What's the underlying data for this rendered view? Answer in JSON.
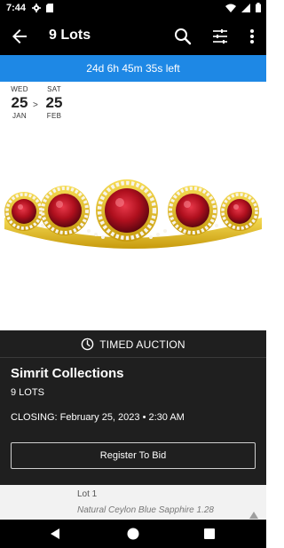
{
  "status_bar": {
    "time": "7:44",
    "icons": [
      "gear-icon",
      "sd-card-icon",
      "wifi-icon",
      "signal-icon",
      "battery-icon"
    ]
  },
  "app_bar": {
    "title": "9 Lots",
    "icons": [
      "back-arrow-icon",
      "search-icon",
      "filter-icon",
      "more-vert-icon"
    ]
  },
  "countdown": {
    "text": "24d 6h 45m 35s left",
    "color": "#1e88e5"
  },
  "date_range": {
    "start": {
      "dow": "WED",
      "day": "25",
      "month": "JAN"
    },
    "separator": ">",
    "end": {
      "dow": "SAT",
      "day": "25",
      "month": "FEB"
    }
  },
  "lot_image": {
    "icon": "ruby-ring-image",
    "gem_color": "#b0101e",
    "metal_color": "#e8c21a"
  },
  "auction": {
    "type_label": "TIMED AUCTION",
    "type_icon": "clock-icon",
    "collection_name": "Simrit Collections",
    "lot_count": "9 LOTS",
    "closing": "CLOSING: February 25, 2023 • 2:30 AM",
    "register_label": "Register To Bid"
  },
  "lot_preview": {
    "lot_number": "Lot 1",
    "title": "Natural Ceylon Blue Sapphire 1.28"
  },
  "nav_bar": {
    "icons": [
      "nav-back-icon",
      "nav-home-icon",
      "nav-recents-icon"
    ]
  }
}
